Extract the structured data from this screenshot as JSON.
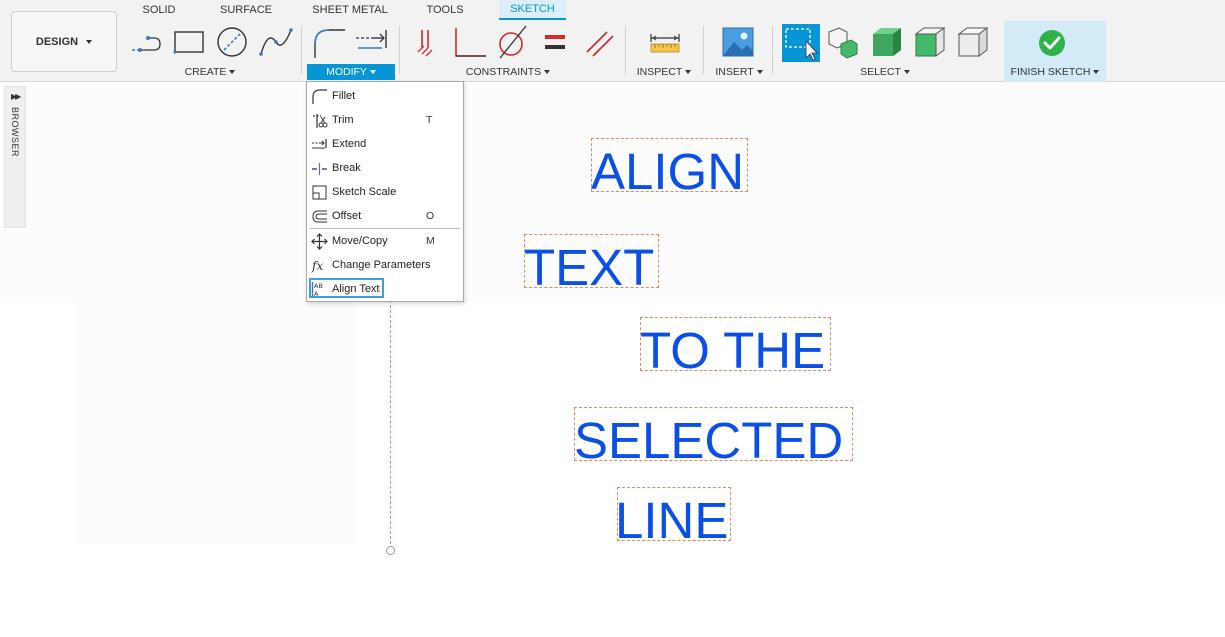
{
  "toolbar": {
    "workspace_button": "DESIGN",
    "tabs": [
      "SOLID",
      "SURFACE",
      "SHEET METAL",
      "TOOLS",
      "SKETCH"
    ],
    "active_tab": "SKETCH",
    "groups": {
      "create": "CREATE",
      "modify": "MODIFY",
      "constraints": "CONSTRAINTS",
      "inspect": "INSPECT",
      "insert": "INSERT",
      "select": "SELECT",
      "finish": "FINISH SKETCH"
    },
    "accent_color": "#0696d7",
    "finish_color": "#2db34a"
  },
  "browser": {
    "label": "BROWSER",
    "arrow": "▶▶"
  },
  "modify_menu": {
    "items": [
      {
        "label": "Fillet",
        "key": "",
        "icon": "fillet-icon"
      },
      {
        "label": "Trim",
        "key": "T",
        "icon": "trim-icon"
      },
      {
        "label": "Extend",
        "key": "",
        "icon": "extend-icon"
      },
      {
        "label": "Break",
        "key": "",
        "icon": "break-icon"
      },
      {
        "label": "Sketch Scale",
        "key": "",
        "icon": "sketch-scale-icon"
      },
      {
        "label": "Offset",
        "key": "O",
        "icon": "offset-icon"
      },
      {
        "label": "Move/Copy",
        "key": "M",
        "icon": "move-copy-icon"
      },
      {
        "label": "Change Parameters",
        "key": "",
        "icon": "fx-icon"
      },
      {
        "label": "Align Text",
        "key": "",
        "icon": "align-text-icon"
      }
    ],
    "highlighted": "Align Text"
  },
  "sketch": {
    "texts": [
      "ALIGN",
      "TEXT",
      "TO THE",
      "SELECTED",
      "LINE"
    ],
    "text_color": "#0a4fe8",
    "outline_color": "#e0895a"
  }
}
